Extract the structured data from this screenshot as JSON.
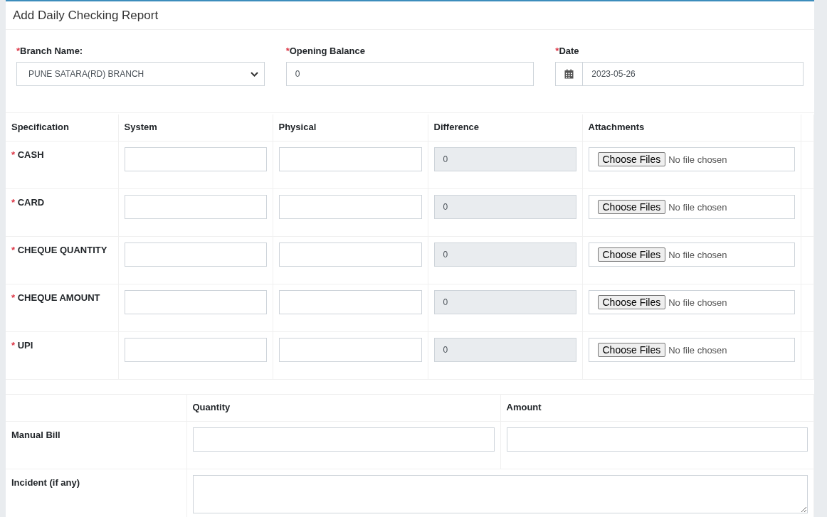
{
  "title": "Add Daily Checking Report",
  "fields": [
    {
      "kind": "select",
      "required_mark": "*",
      "label": "Branch Name:",
      "value": "PUNE SATARA(RD) BRANCH"
    },
    {
      "kind": "text",
      "required_mark": "*",
      "label": "Opening Balance",
      "value": "0"
    },
    {
      "kind": "date",
      "required_mark": "*",
      "label": "Date",
      "value": "2023-05-26"
    }
  ],
  "checking_table": {
    "columns": [
      "Specification",
      "System",
      "Physical",
      "Difference",
      "Attachments"
    ],
    "rows": [
      {
        "required_mark": "*",
        "specification": "CASH",
        "difference": "0",
        "file_button": "Choose Files",
        "file_status": "No file chosen"
      },
      {
        "required_mark": "*",
        "specification": "CARD",
        "difference": "0",
        "file_button": "Choose Files",
        "file_status": "No file chosen"
      },
      {
        "required_mark": "*",
        "specification": "CHEQUE QUANTITY",
        "difference": "0",
        "file_button": "Choose Files",
        "file_status": "No file chosen"
      },
      {
        "required_mark": "*",
        "specification": "CHEQUE AMOUNT",
        "difference": "0",
        "file_button": "Choose Files",
        "file_status": "No file chosen"
      },
      {
        "required_mark": "*",
        "specification": "UPI",
        "difference": "0",
        "file_button": "Choose Files",
        "file_status": "No file chosen"
      }
    ]
  },
  "extra_table": {
    "columns": [
      "Quantity",
      "Amount"
    ],
    "rows": [
      {
        "kind": "pair",
        "label": "Manual Bill"
      },
      {
        "kind": "textarea",
        "label": "Incident (if any)"
      }
    ]
  }
}
